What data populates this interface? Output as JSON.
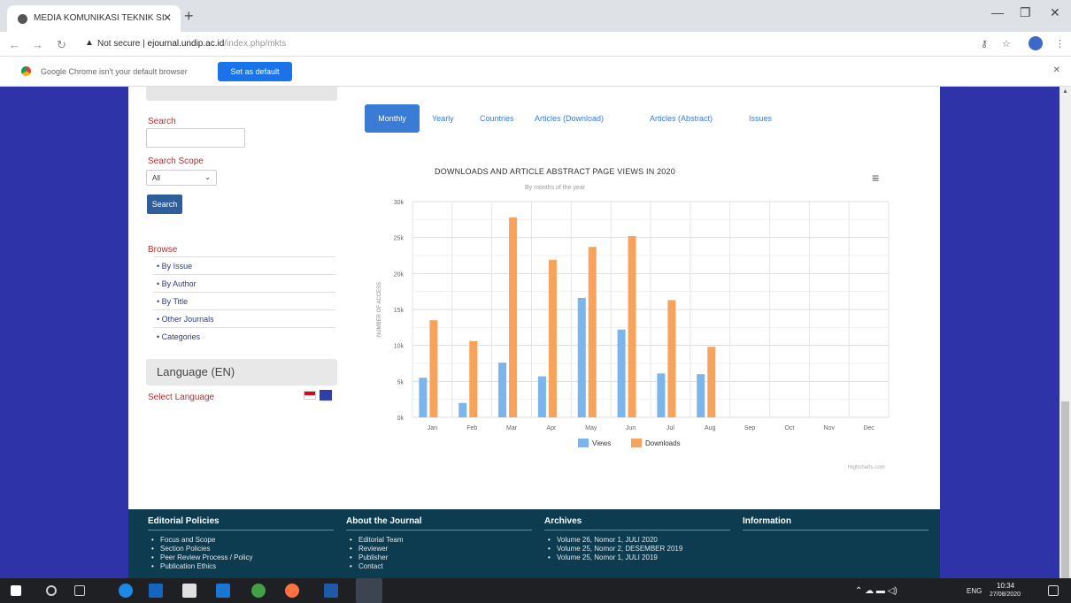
{
  "browser": {
    "tab_title": "MEDIA KOMUNIKASI TEKNIK SI",
    "url_secure": "Not secure",
    "url_host": "ejournal.undip.ac.id",
    "url_path": "/index.php/mkts"
  },
  "infobar": {
    "message": "Google Chrome isn't your default browser",
    "button": "Set as default"
  },
  "sidebar": {
    "search_label": "Search",
    "scope_label": "Search Scope",
    "scope_value": "All",
    "search_button": "Search",
    "browse_label": "Browse",
    "browse_items": [
      "• By Issue",
      "• By Author",
      "• By Title",
      "• Other Journals",
      "• Categories"
    ],
    "language_title": "Language (EN)",
    "select_language": "Select Language"
  },
  "tabs": [
    "Monthly",
    "Yearly",
    "Countries",
    "Articles (Download)",
    "Articles (Abstract)",
    "Issues"
  ],
  "chart_data": {
    "type": "bar",
    "title": "DOWNLOADS AND ARTICLE ABSTRACT PAGE VIEWS IN 2020",
    "subtitle": "By months of the year",
    "ylabel": "NUMBER OF ACCESS",
    "ylim": [
      0,
      30000
    ],
    "yticks": [
      "0k",
      "5k",
      "10k",
      "15k",
      "20k",
      "25k",
      "30k"
    ],
    "categories": [
      "Jan",
      "Feb",
      "Mar",
      "Apr",
      "May",
      "Jun",
      "Jul",
      "Aug",
      "Sep",
      "Oct",
      "Nov",
      "Dec"
    ],
    "series": [
      {
        "name": "Views",
        "color": "#7cb5ec",
        "values": [
          5500,
          2000,
          7600,
          5700,
          16600,
          12200,
          6100,
          6000,
          0,
          0,
          0,
          0
        ]
      },
      {
        "name": "Downloads",
        "color": "#f7a35c",
        "values": [
          13500,
          10600,
          27800,
          21900,
          23700,
          25200,
          16300,
          9800,
          0,
          0,
          0,
          0
        ]
      }
    ],
    "legend": "bottom-center",
    "credits": "Highcharts.com"
  },
  "footer": {
    "col1": {
      "title": "Editorial Policies",
      "items": [
        "Focus and Scope",
        "Section Policies",
        "Peer Review Process / Policy",
        "Publication Ethics"
      ]
    },
    "col2": {
      "title": "About the Journal",
      "items": [
        "Editorial Team",
        "Reviewer",
        "Publisher",
        "Contact"
      ]
    },
    "col3": {
      "title": "Archives",
      "items": [
        "Volume 26, Nomor 1, JULI 2020",
        "Volume 25, Nomor 2, DESEMBER 2019",
        "Volume 25, Nomor 1, JULI 2019"
      ]
    },
    "col4": {
      "title": "Information"
    }
  },
  "taskbar": {
    "lang": "ENG",
    "time": "10:34",
    "date": "27/08/2020"
  }
}
